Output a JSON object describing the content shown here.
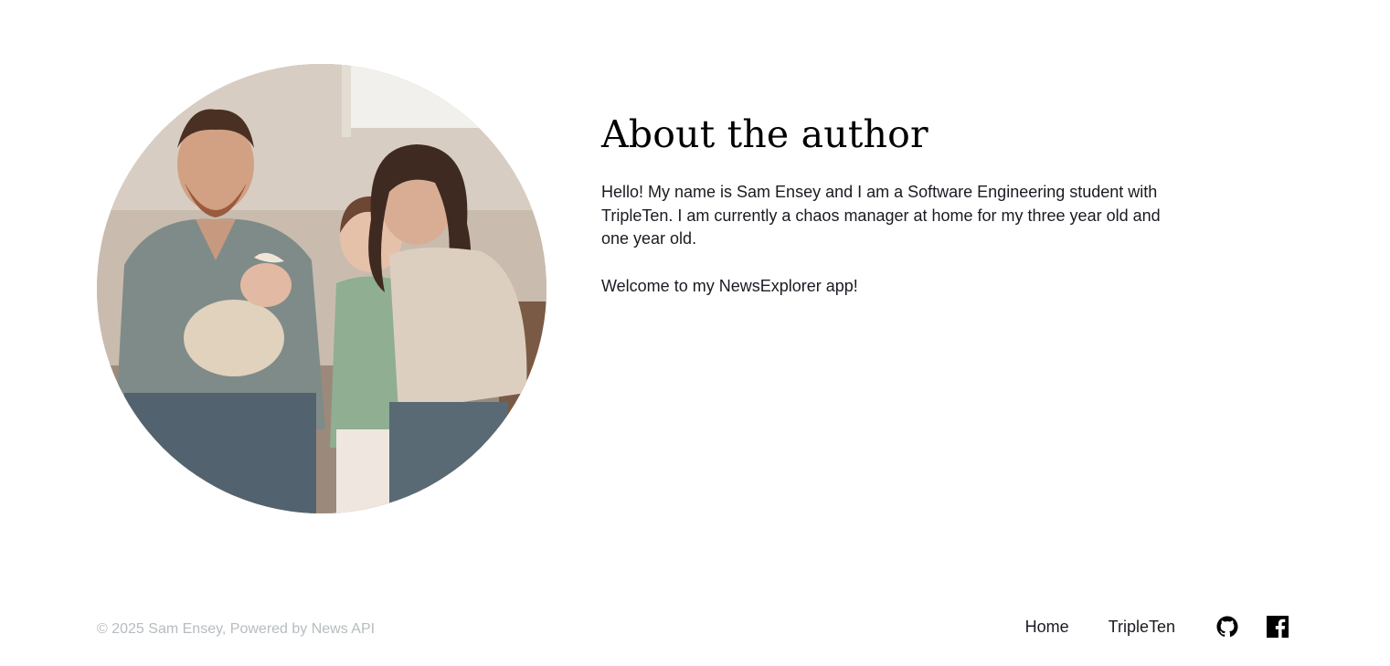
{
  "about": {
    "title": "About the author",
    "paragraph_1": "Hello! My name is Sam Ensey and I am a Software Engineering student with TripleTen. I am currently a chaos manager at home for my three year old and one year old.",
    "paragraph_2": "Welcome to my NewsExplorer app!",
    "photo_icon": "family-photo"
  },
  "footer": {
    "copyright": "© 2025 Sam Ensey, Powered by News API",
    "links": {
      "home": "Home",
      "tripleten": "TripleTen"
    },
    "icons": {
      "github": "github-icon",
      "facebook": "facebook-icon"
    }
  },
  "colors": {
    "text": "#1a1b22",
    "muted": "#b6bcbf",
    "background": "#ffffff"
  }
}
